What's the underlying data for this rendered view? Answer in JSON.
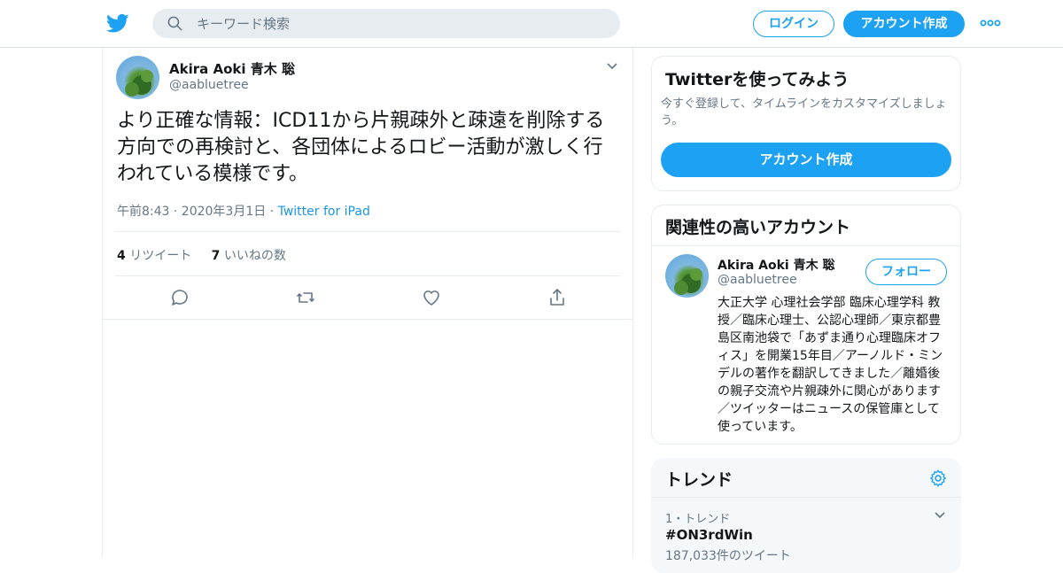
{
  "brand": {
    "accent": "#1da1f2",
    "logo_icon": "twitter-bird-icon"
  },
  "header": {
    "search_placeholder": "キーワード検索",
    "login_label": "ログイン",
    "signup_label": "アカウント作成",
    "more_icon": "more-dots-icon"
  },
  "tweet": {
    "author_name": "Akira Aoki 青木 聡",
    "author_handle": "@aabluetree",
    "text": "より正確な情報：ICD11から片親疎外と疎遠を削除する方向での再検討と、各団体によるロビー活動が激しく行われている模様です。",
    "time": "午前8:43 · 2020年3月1日 · ",
    "source": "Twitter for iPad",
    "retweet_count": "4",
    "retweet_label": " リツイート",
    "like_count": "7",
    "like_label": " いいねの数"
  },
  "sidebar": {
    "try_twitter": {
      "title": "Twitterを使ってみよう",
      "subtitle": "今すぐ登録して、タイムラインをカスタマイズしましょう。",
      "button_label": "アカウント作成"
    },
    "related": {
      "title": "関連性の高いアカウント",
      "account_name": "Akira Aoki 青木 聡",
      "account_handle": "@aabluetree",
      "follow_label": "フォロー",
      "bio": "大正大学 心理社会学部 臨床心理学科 教授／臨床心理士、公認心理師／東京都豊島区南池袋で「あずま通り心理臨床オフィス」を開業15年目／アーノルド・ミンデルの著作を翻訳してきました／離婚後の親子交流や片親疎外に関心があります／ツイッターはニュースの保管庫として使っています。"
    },
    "trends": {
      "title": "トレンド",
      "items": [
        {
          "rank_label": "1・トレンド",
          "name": "#ON3rdWin",
          "count": "187,033件のツイート"
        }
      ]
    }
  }
}
